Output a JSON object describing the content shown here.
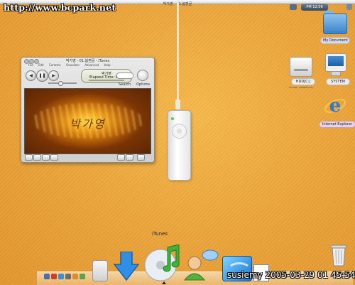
{
  "watermark": "http://www.bcpark.net",
  "menubar": {
    "window_title": "박가영 - 01.봄편골",
    "clock": "PM 12:56"
  },
  "itunes": {
    "title": "박가영 - 01.봄편골 - iTunes",
    "menu": [
      "File",
      "Edit",
      "Controls",
      "Visualizer",
      "Advanced",
      "Help"
    ],
    "lcd_song": "박가영",
    "lcd_time": "Elapsed Time: 0:38",
    "search_label": "Search",
    "options_label": "Options",
    "visualizer_text": "박가영"
  },
  "desktop_icons": {
    "my_document": "My Document",
    "hdd_label": "HDD[C:]",
    "hdd_sub": "38.2GB / 19GB(50.2%)",
    "system_label": "SYSTEM",
    "ie_label": "Internet Explorer"
  },
  "dock": {
    "hover_label": "iTunes"
  },
  "clock_text": "susiemy 2005-03-29 01 45:54",
  "colors": {
    "desktop": "#eca53a",
    "itunes_window": "#dcdcdc",
    "ie_label_bg": "#e9d2e6"
  }
}
